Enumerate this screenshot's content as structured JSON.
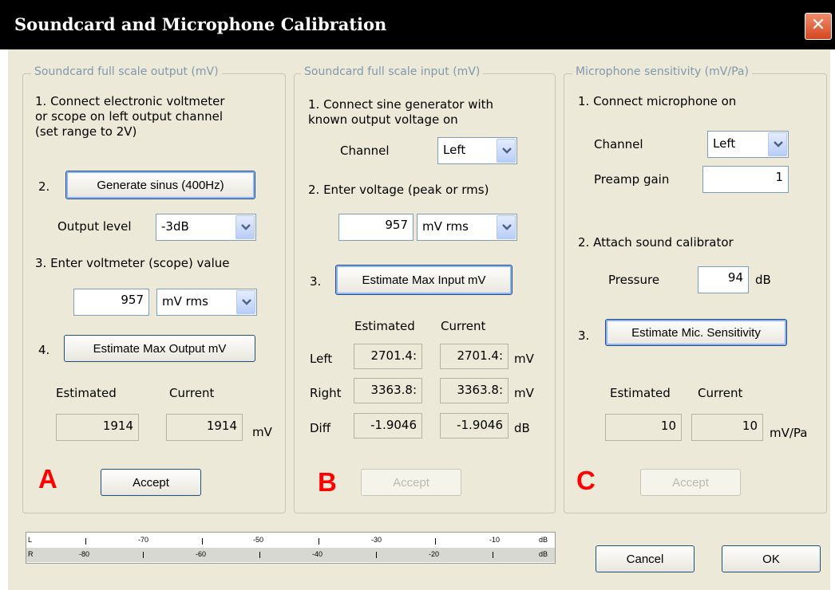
{
  "window": {
    "title": "Soundcard and Microphone Calibration",
    "close_glyph": "✕"
  },
  "group_a": {
    "legend": "Soundcard full scale output (mV)",
    "step1_lines": [
      "1. Connect electronic voltmeter",
      "or scope on left output channel",
      "(set range  to 2V)"
    ],
    "step2_num": "2.",
    "generate_button": "Generate sinus (400Hz)",
    "output_level_label": "Output level",
    "output_level_value": "-3dB",
    "step3": "3. Enter voltmeter (scope) value",
    "voltage_value": "957",
    "unit_value": "mV rms",
    "step4_num": "4.",
    "estimate_button": "Estimate Max Output mV",
    "estimated_label": "Estimated",
    "current_label": "Current",
    "estimated_value": "1914",
    "current_value": "1914",
    "unit": "mV",
    "letter": "A",
    "accept_button": "Accept"
  },
  "group_b": {
    "legend": "Soundcard full scale  input (mV)",
    "step1_lines": [
      "1. Connect sine generator with",
      "known output voltage on"
    ],
    "channel_label": "Channel",
    "channel_value": "Left",
    "step2": "2. Enter voltage (peak or rms)",
    "voltage_value": "957",
    "unit_value": "mV rms",
    "step3_num": "3.",
    "estimate_button": "Estimate Max Input mV",
    "estimated_label": "Estimated",
    "current_label": "Current",
    "rows": [
      {
        "label": "Left",
        "estimated": "2701.4:",
        "current": "2701.4:",
        "unit": "mV"
      },
      {
        "label": "Right",
        "estimated": "3363.8:",
        "current": "3363.8:",
        "unit": "mV"
      },
      {
        "label": "Diff",
        "estimated": "-1.9046",
        "current": "-1.9046",
        "unit": "dB"
      }
    ],
    "letter": "B",
    "accept_button": "Accept"
  },
  "group_c": {
    "legend": "Microphone sensitivity (mV/Pa)",
    "step1": "1. Connect microphone on",
    "channel_label": "Channel",
    "channel_value": "Left",
    "preamp_label": "Preamp  gain",
    "preamp_value": "1",
    "step2": "2. Attach sound calibrator",
    "pressure_label": "Pressure",
    "pressure_value": "94",
    "pressure_unit": "dB",
    "step3_num": "3.",
    "estimate_button": "Estimate Mic. Sensitivity",
    "estimated_label": "Estimated",
    "current_label": "Current",
    "estimated_value": "10",
    "current_value": "10",
    "unit": "mV/Pa",
    "letter": "C",
    "accept_button": "Accept"
  },
  "meter": {
    "row_l": "L",
    "row_r": "R",
    "top_labels": [
      "-70",
      "-50",
      "-30",
      "-10",
      "dB"
    ],
    "bottom_labels": [
      "-80",
      "-60",
      "-40",
      "-20",
      "dB"
    ]
  },
  "buttons": {
    "cancel": "Cancel",
    "ok": "OK"
  },
  "colors": {
    "accent_red": "#ff0000",
    "legend_text": "#8298ad",
    "window_bg": "#ece9d8"
  }
}
